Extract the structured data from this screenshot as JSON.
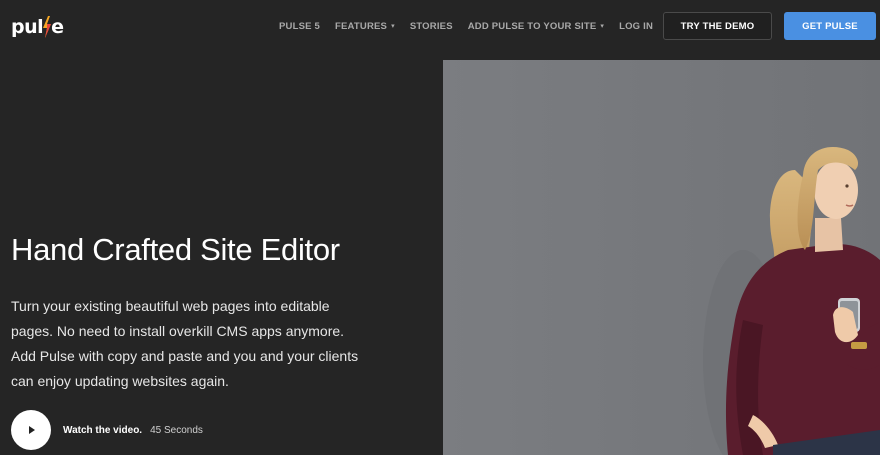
{
  "brand": {
    "logo_left": "pul",
    "logo_right": "e",
    "accent": "#f5a623",
    "accent_red": "#e8453c"
  },
  "nav": {
    "items": [
      {
        "label": "PULSE 5",
        "dropdown": false
      },
      {
        "label": "FEATURES",
        "dropdown": true
      },
      {
        "label": "STORIES",
        "dropdown": false
      },
      {
        "label": "ADD PULSE TO YOUR SITE",
        "dropdown": true
      },
      {
        "label": "LOG IN",
        "dropdown": false
      }
    ],
    "caret": "⌄"
  },
  "buttons": {
    "demo_label": "TRY THE DEMO",
    "get_label": "GET PULSE",
    "get_color": "#4a90e2"
  },
  "hero": {
    "title": "Hand Crafted Site Editor",
    "description": "Turn your existing beautiful web pages into editable pages. No need to install overkill CMS apps anymore. Add Pulse with copy and paste and you and your clients can enjoy updating websites again.",
    "watch_label": "Watch the video.",
    "duration": "45 Seconds",
    "play_icon": "play-icon"
  }
}
